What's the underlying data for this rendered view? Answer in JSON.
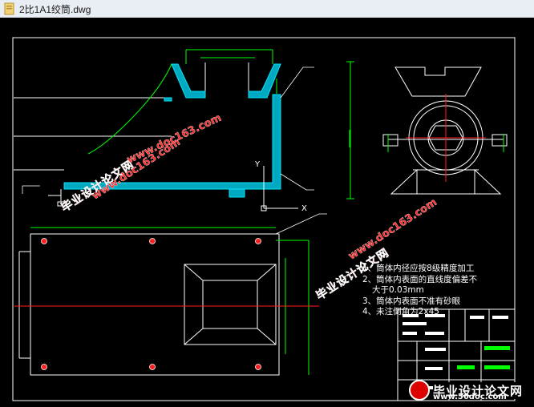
{
  "window": {
    "title": "2比1A1绞筒.dwg",
    "icon": "dwg-file-icon"
  },
  "drawing": {
    "axis_y_label": "Y",
    "axis_x_label": "X",
    "notes": [
      "1、筒体内径应按8级精度加工",
      "2、筒体内表面的直线度偏差不",
      "大于0.03mm",
      "3、筒体内表面不准有砂眼",
      "4、未注倒角为2x45"
    ]
  },
  "watermarks": {
    "cn_text": "毕业设计论文网",
    "url_text": "www.doc163.com",
    "brand_name": "毕业设计论文网",
    "brand_url": "www.56doc.com"
  },
  "colors": {
    "background": "#000000",
    "cyan": "#00e5ff",
    "green": "#00ff00",
    "red": "#ff2020",
    "white": "#ffffff"
  }
}
